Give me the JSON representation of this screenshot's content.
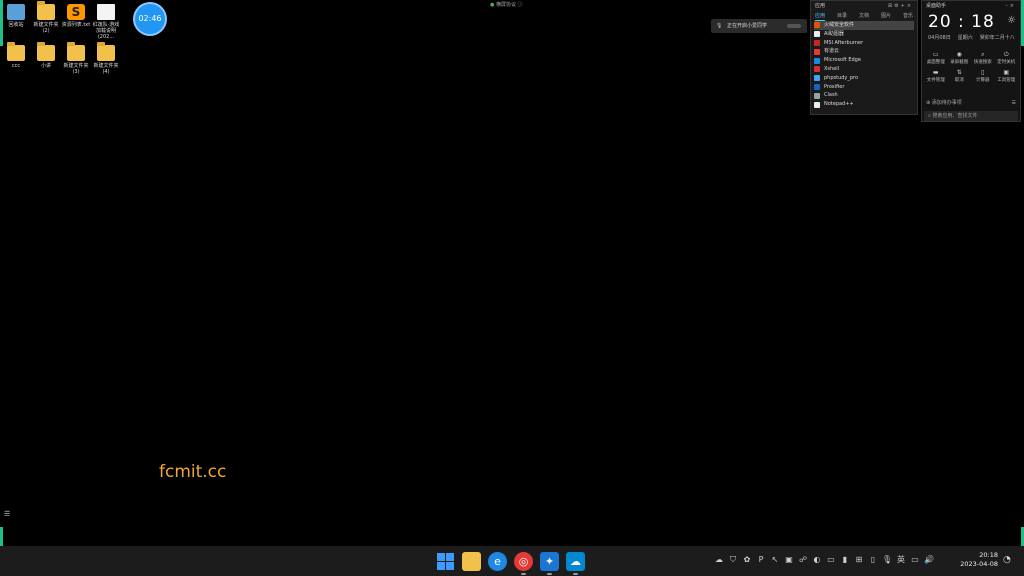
{
  "desktop_icons": [
    {
      "label": "回收站",
      "kind": "recycle"
    },
    {
      "label": "新建文件夹(2)",
      "kind": "folder"
    },
    {
      "label": "资源列表.txt",
      "kind": "sublime"
    },
    {
      "label": "红莲队·游戏加载说明(202...",
      "kind": "doc"
    },
    {
      "label": "ccc",
      "kind": "folder"
    },
    {
      "label": "小讲",
      "kind": "folder"
    },
    {
      "label": "新建文件夹(3)",
      "kind": "folder"
    },
    {
      "label": "新建文件夹(4)",
      "kind": "folder"
    }
  ],
  "clock_bubble": "02:46",
  "top_center": "横屏协议",
  "notification": "正在开启小爱同学",
  "search_panel": {
    "title": "应用",
    "tabs": [
      "应用",
      "目录",
      "文档",
      "图片",
      "音乐"
    ],
    "items": [
      "火绒安全软件",
      "AI助图器",
      "MSI Afterburner",
      "有道云",
      "Microsoft Edge",
      "Xshell",
      "phpstudy_pro",
      "Proxifier",
      "Clash",
      "Notepad++"
    ]
  },
  "clock_panel": {
    "title": "桌面助手",
    "time": "20 : 18",
    "date": "04月08日",
    "weekday": "星期六",
    "lunar": "癸卯年二月十八",
    "shortcuts": [
      "桌面整理",
      "录屏截图",
      "快速搜索",
      "定时关机",
      "文件管理",
      "取消",
      "计算器",
      "工具管理"
    ],
    "footer": "添加待办事项",
    "search_placeholder": "搜索应用、查找文件"
  },
  "watermark": "fcmit.cc",
  "taskbar": {
    "time": "20:18",
    "date": "2023-04-08",
    "ime": "英"
  },
  "colors": {
    "accent": "#1fbf8a",
    "watermark": "#f0a830",
    "clock_bubble": "#2196f3"
  }
}
